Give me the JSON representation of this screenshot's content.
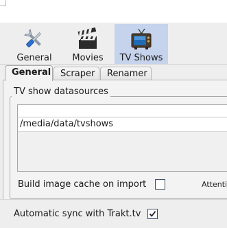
{
  "toolbar": {
    "items": [
      {
        "label": "General",
        "icon": "tools-icon"
      },
      {
        "label": "Movies",
        "icon": "clapperboard-icon"
      },
      {
        "label": "TV Shows",
        "icon": "tv-icon",
        "active": true
      }
    ]
  },
  "tabs": [
    {
      "label": "General",
      "selected": true
    },
    {
      "label": "Scraper"
    },
    {
      "label": "Renamer"
    }
  ],
  "datasources": {
    "group_title": "TV show datasources",
    "items": [
      "/media/data/tvshows"
    ]
  },
  "options": {
    "build_image_cache_label": "Build image cache on import",
    "build_image_cache_checked": false,
    "attention_label": "Attenti",
    "trakt_sync_label": "Automatic sync with Trakt.tv",
    "trakt_sync_checked": true
  },
  "colors": {
    "active_toolbar_bg": "#c6d3ec",
    "checkbox_border": "#3a4b66"
  }
}
